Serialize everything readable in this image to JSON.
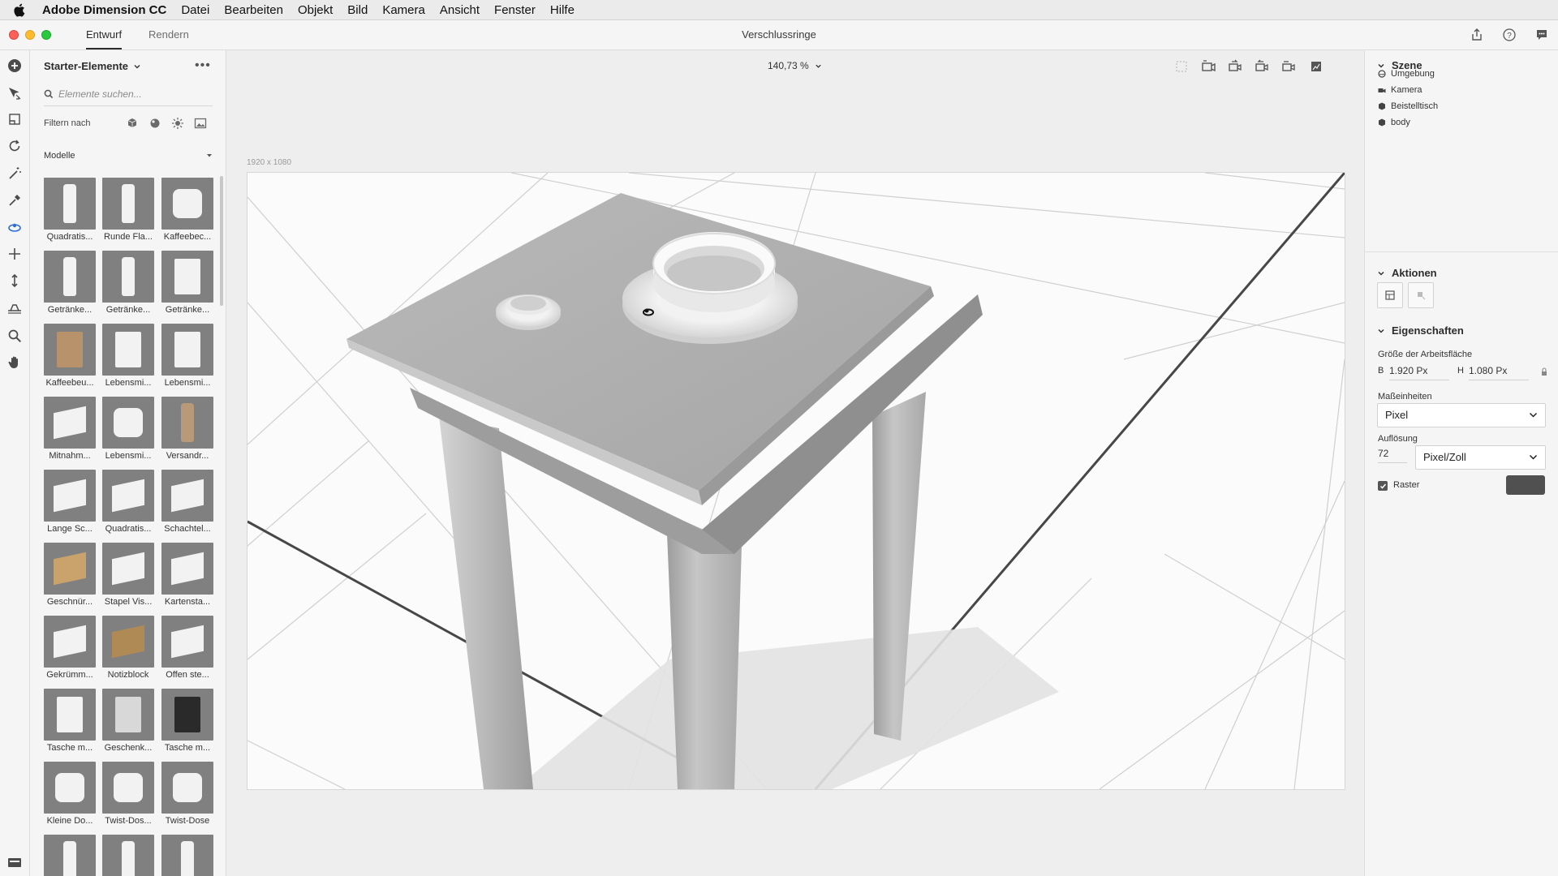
{
  "menubar": {
    "app_name": "Adobe Dimension CC",
    "items": [
      "Datei",
      "Bearbeiten",
      "Objekt",
      "Bild",
      "Kamera",
      "Ansicht",
      "Fenster",
      "Hilfe"
    ]
  },
  "titlebar": {
    "tabs": [
      "Entwurf",
      "Rendern"
    ],
    "active_tab": "Entwurf",
    "document_title": "Verschlussringe"
  },
  "left_panel": {
    "header": "Starter-Elemente",
    "search_placeholder": "Elemente suchen...",
    "filter_label": "Filtern nach",
    "section_title": "Modelle",
    "assets": [
      {
        "label": "Quadratis...",
        "icon": "square-bottle"
      },
      {
        "label": "Runde Fla...",
        "icon": "round-bottle"
      },
      {
        "label": "Kaffeebec...",
        "icon": "coffee-cup"
      },
      {
        "label": "Getränke...",
        "icon": "beverage-can"
      },
      {
        "label": "Getränke...",
        "icon": "beverage-can-slim"
      },
      {
        "label": "Getränke...",
        "icon": "beverage-carton"
      },
      {
        "label": "Kaffeebeu...",
        "icon": "coffee-bag"
      },
      {
        "label": "Lebensmi...",
        "icon": "food-pouch"
      },
      {
        "label": "Lebensmi...",
        "icon": "food-bag"
      },
      {
        "label": "Mitnahm...",
        "icon": "takeout-box"
      },
      {
        "label": "Lebensmi...",
        "icon": "food-cup"
      },
      {
        "label": "Versandr...",
        "icon": "mailing-tube"
      },
      {
        "label": "Lange Sc...",
        "icon": "long-box"
      },
      {
        "label": "Quadratis...",
        "icon": "square-box"
      },
      {
        "label": "Schachtel...",
        "icon": "flat-box"
      },
      {
        "label": "Geschnür...",
        "icon": "tied-package"
      },
      {
        "label": "Stapel Vis...",
        "icon": "business-cards"
      },
      {
        "label": "Kartensta...",
        "icon": "card-stack"
      },
      {
        "label": "Gekrümm...",
        "icon": "curved-paper"
      },
      {
        "label": "Notizblock",
        "icon": "notepad"
      },
      {
        "label": "Offen ste...",
        "icon": "open-box"
      },
      {
        "label": "Tasche m...",
        "icon": "shopping-bag"
      },
      {
        "label": "Geschenk...",
        "icon": "gift-bag"
      },
      {
        "label": "Tasche m...",
        "icon": "black-bag"
      },
      {
        "label": "Kleine Do...",
        "icon": "small-tin"
      },
      {
        "label": "Twist-Dos...",
        "icon": "twist-jar"
      },
      {
        "label": "Twist-Dose",
        "icon": "twist-tin"
      },
      {
        "label": "",
        "icon": "pump-bottle"
      },
      {
        "label": "",
        "icon": "spray-bottle"
      },
      {
        "label": "",
        "icon": "tube"
      }
    ]
  },
  "canvas": {
    "zoom": "140,73 %",
    "size_label": "1920 x 1080"
  },
  "right_panel": {
    "scene_title": "Szene",
    "scene_items": [
      {
        "label": "Umgebung",
        "icon": "environment-icon"
      },
      {
        "label": "Kamera",
        "icon": "camera-icon"
      },
      {
        "label": "Beistelltisch",
        "icon": "model-icon"
      },
      {
        "label": "body",
        "icon": "model-icon"
      }
    ],
    "actions_title": "Aktionen",
    "properties_title": "Eigenschaften",
    "artboard_size_label": "Größe der Arbeitsfläche",
    "width_letter": "B",
    "width_value": "1.920 Px",
    "height_letter": "H",
    "height_value": "1.080 Px",
    "units_label": "Maßeinheiten",
    "units_value": "Pixel",
    "resolution_label": "Auflösung",
    "resolution_value": "72",
    "resolution_unit": "Pixel/Zoll",
    "grid_label": "Raster",
    "grid_checked": true,
    "grid_color": "#505050"
  }
}
